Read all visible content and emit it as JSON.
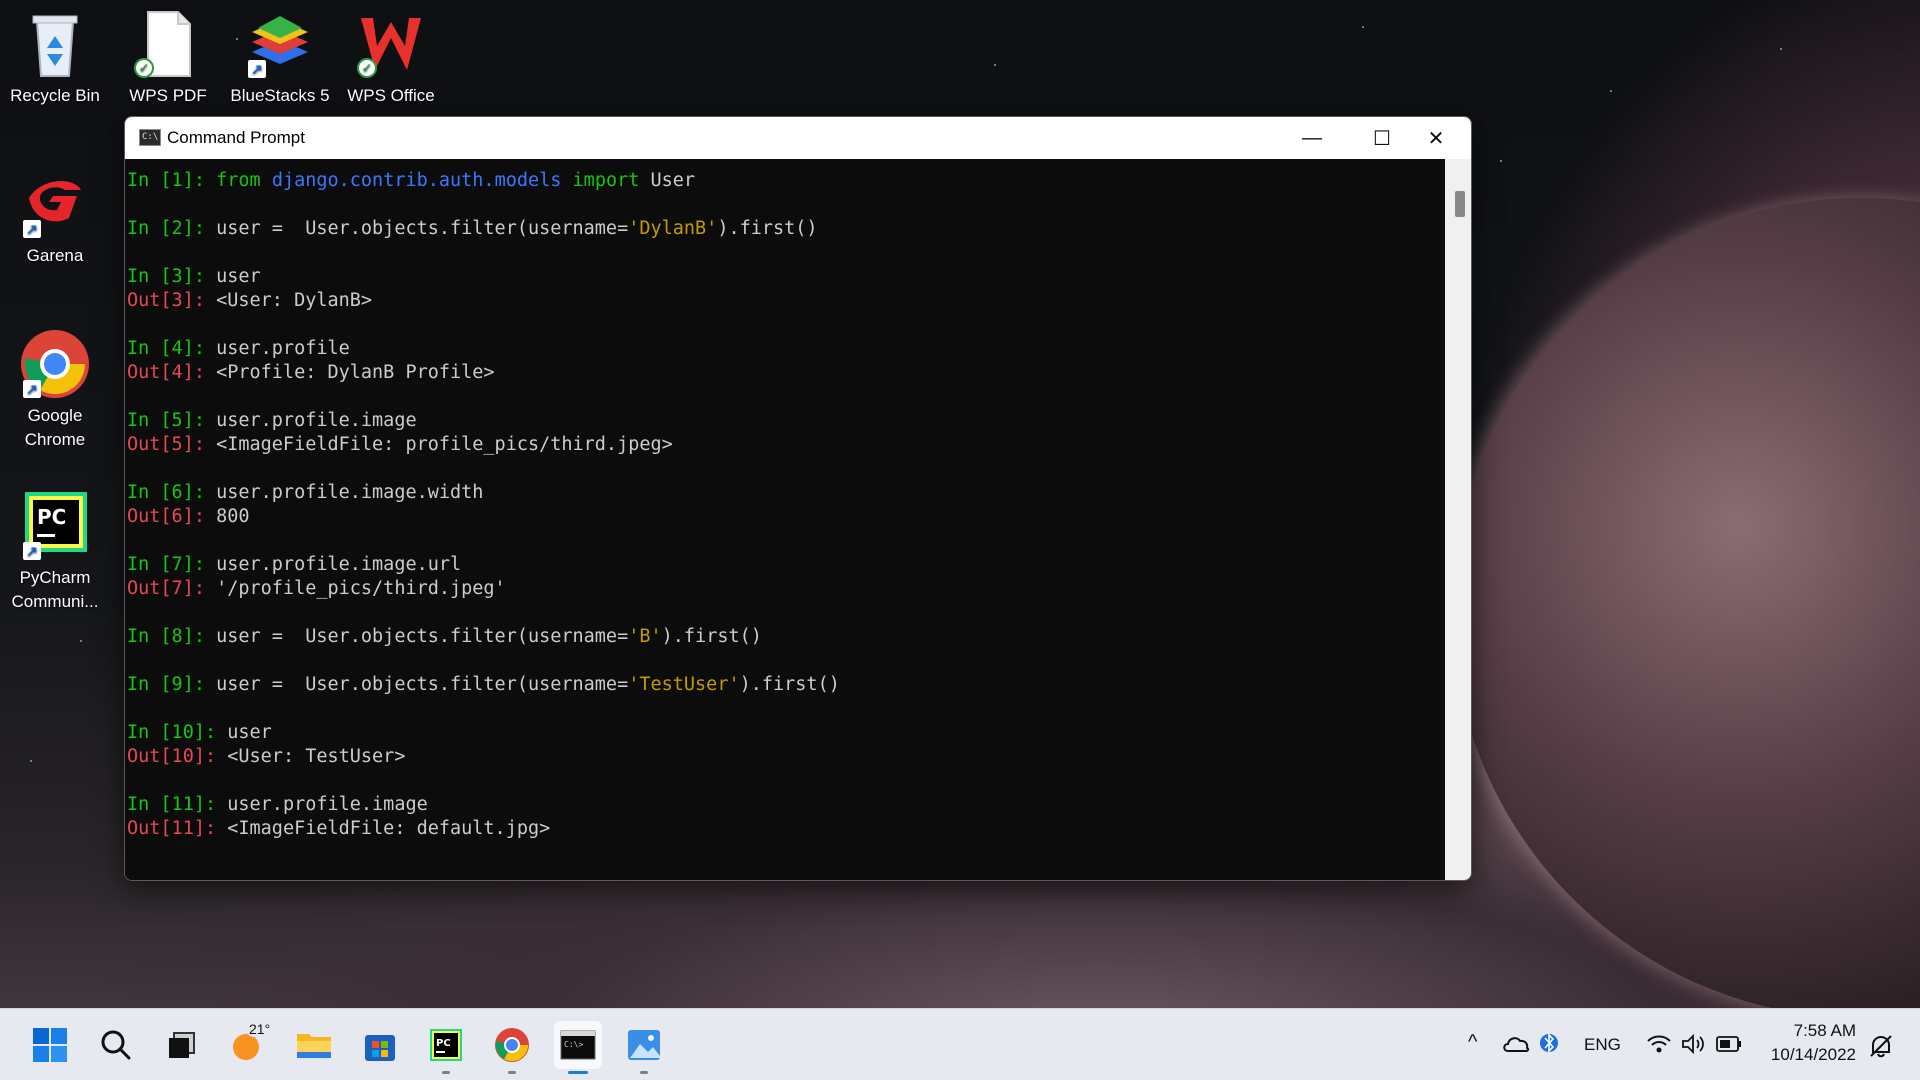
{
  "desktop": {
    "icons": [
      {
        "label": "Recycle Bin"
      },
      {
        "label": "WPS PDF"
      },
      {
        "label": "BlueStacks 5"
      },
      {
        "label": "WPS Office"
      },
      {
        "label": "Garena"
      },
      {
        "label": "Google Chrome"
      },
      {
        "label": "PyCharm Communi..."
      }
    ],
    "icon_names": [
      "recycle-bin-icon",
      "wps-pdf-icon",
      "bluestacks-icon",
      "wps-office-icon",
      "garena-icon",
      "chrome-icon",
      "pycharm-icon"
    ]
  },
  "window": {
    "title": "Command Prompt",
    "min_glyph": "—",
    "max_glyph": "☐",
    "close_glyph": "✕"
  },
  "console": {
    "lines": [
      {
        "p1": "In [1]: ",
        "kw1": "from ",
        "mod": "django.contrib.auth.models",
        "kw2": " import ",
        "rest": "User"
      },
      {
        "p1": "In [2]: ",
        "code1": "user =  User.objects.filter(username=",
        "str": "'DylanB'",
        "code2": ").first()"
      },
      {
        "p1": "In [3]: ",
        "code": "user"
      },
      {
        "p1": "Out[3]: ",
        "code": "<User: DylanB>"
      },
      {
        "p1": "In [4]: ",
        "code": "user.profile"
      },
      {
        "p1": "Out[4]: ",
        "code": "<Profile: DylanB Profile>"
      },
      {
        "p1": "In [5]: ",
        "code": "user.profile.image"
      },
      {
        "p1": "Out[5]: ",
        "code": "<ImageFieldFile: profile_pics/third.jpeg>"
      },
      {
        "p1": "In [6]: ",
        "code": "user.profile.image.width"
      },
      {
        "p1": "Out[6]: ",
        "code": "800"
      },
      {
        "p1": "In [7]: ",
        "code": "user.profile.image.url"
      },
      {
        "p1": "Out[7]: ",
        "code": "'/profile_pics/third.jpeg'"
      },
      {
        "p1": "In [8]: ",
        "code1": "user =  User.objects.filter(username=",
        "str": "'B'",
        "code2": ").first()"
      },
      {
        "p1": "In [9]: ",
        "code1": "user =  User.objects.filter(username=",
        "str": "'TestUser'",
        "code2": ").first()"
      },
      {
        "p1": "In [10]: ",
        "code": "user"
      },
      {
        "p1": "Out[10]: ",
        "code": "<User: TestUser>"
      },
      {
        "p1": "In [11]: ",
        "code": "user.profile.image"
      },
      {
        "p1": "Out[11]: ",
        "code": "<ImageFieldFile: default.jpg>"
      }
    ]
  },
  "taskbar": {
    "weather_temp": "21°",
    "tray": {
      "language": "ENG",
      "time": "7:58 AM",
      "date": "10/14/2022"
    }
  },
  "colors": {
    "prompt_in": "#16c60c",
    "prompt_out": "#e74856",
    "module": "#3b78ff",
    "string": "#c19c00"
  }
}
